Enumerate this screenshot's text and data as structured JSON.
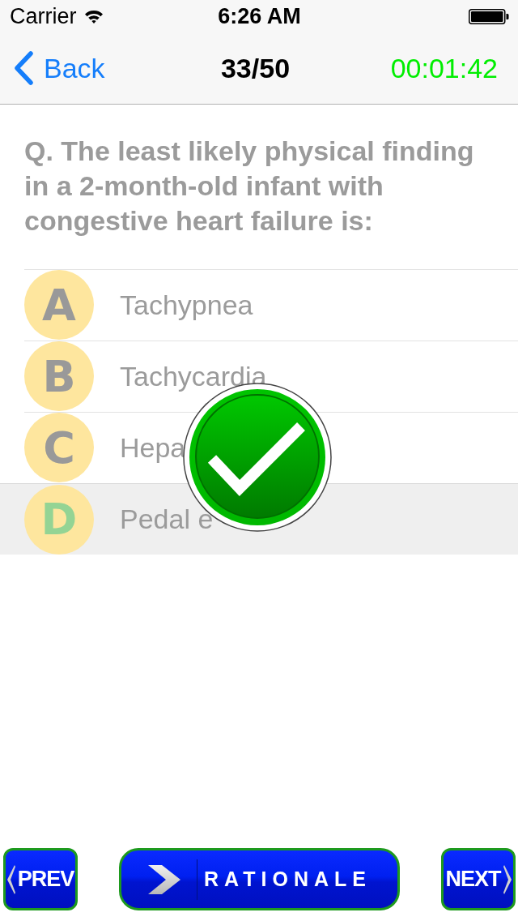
{
  "status_bar": {
    "carrier": "Carrier",
    "time": "6:26 AM"
  },
  "nav_bar": {
    "back": "Back",
    "title": "33/50",
    "timer": "00:01:42"
  },
  "question": "Q. The least likely physical finding in a 2-month-old infant with congestive heart failure is:",
  "options": [
    {
      "letter": "A",
      "text": "Tachypnea",
      "selected": false,
      "correct": false
    },
    {
      "letter": "B",
      "text": "Tachycardia",
      "selected": false,
      "correct": false
    },
    {
      "letter": "C",
      "text": "Hepa",
      "selected": false,
      "correct": false
    },
    {
      "letter": "D",
      "text": "Pedal e",
      "selected": true,
      "correct": true
    }
  ],
  "feedback": {
    "correct": true
  },
  "buttons": {
    "prev": "PREV",
    "rationale": "RATIONALE",
    "next": "NEXT"
  }
}
